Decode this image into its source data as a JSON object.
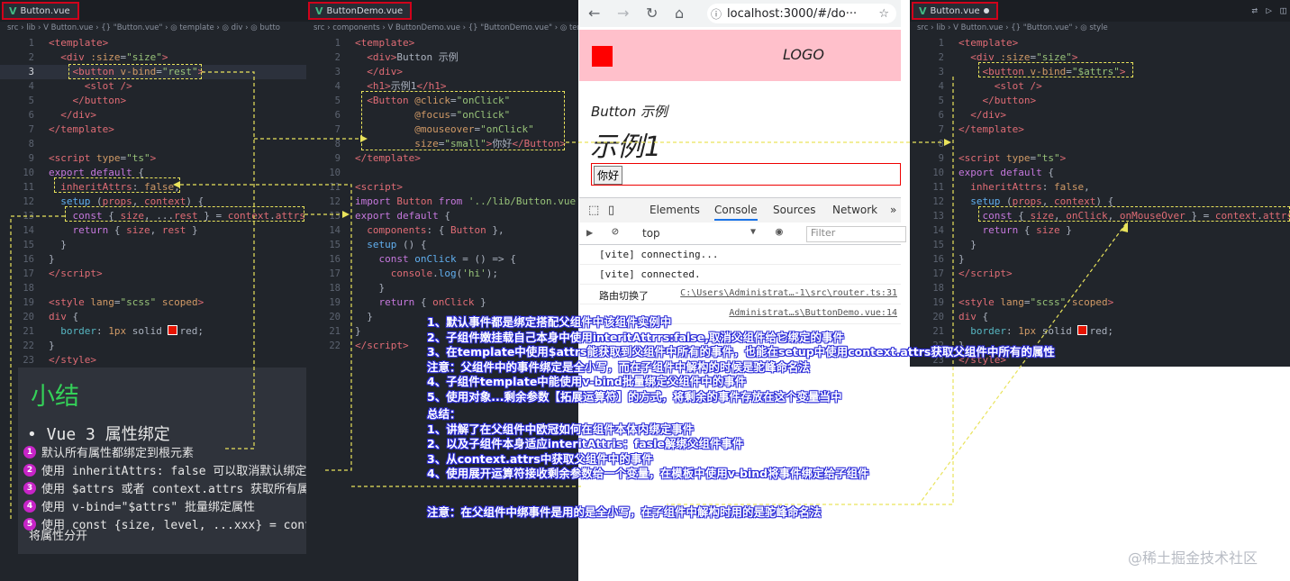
{
  "left_pane": {
    "tab": "Button.vue",
    "breadcrumb": "src › lib › V Button.vue › {} \"Button.vue\" › ◎ template › ◎ div › ◎ butto",
    "lines": [
      {
        "n": "1",
        "html": "<span class='t'>&lt;template&gt;</span>"
      },
      {
        "n": "2",
        "html": "  <span class='t'>&lt;div</span> <span class='a'>:size</span>=<span class='s'>\"size\"</span><span class='t'>&gt;</span>"
      },
      {
        "n": "3",
        "html": "    <span class='t'>&lt;button</span> <span class='a'>v-bind</span>=<span class='s'>\"rest\"</span><span class='t'>&gt;</span>"
      },
      {
        "n": "4",
        "html": "      <span class='t'>&lt;slot /&gt;</span>"
      },
      {
        "n": "5",
        "html": "    <span class='t'>&lt;/button&gt;</span>"
      },
      {
        "n": "6",
        "html": "  <span class='t'>&lt;/div&gt;</span>"
      },
      {
        "n": "7",
        "html": "<span class='t'>&lt;/template&gt;</span>"
      },
      {
        "n": "8",
        "html": ""
      },
      {
        "n": "9",
        "html": "<span class='t'>&lt;script</span> <span class='a'>type</span>=<span class='s'>\"ts\"</span><span class='t'>&gt;</span>"
      },
      {
        "n": "10",
        "html": "<span class='k'>export default</span> {"
      },
      {
        "n": "11",
        "html": "  <span class='t'>inheritAttrs</span>: <span class='a'>false</span>,"
      },
      {
        "n": "12",
        "html": "  <span class='f'>setup</span> (<span class='t'>props</span>, <span class='t'>context</span>) {"
      },
      {
        "n": "13",
        "html": "    <span class='k'>const</span> { <span class='t'>size</span>, ...<span class='t'>rest</span> } = <span class='t'>context</span>.<span class='t'>attrs</span>"
      },
      {
        "n": "14",
        "html": "    <span class='k'>return</span> { <span class='t'>size</span>, <span class='t'>rest</span> }"
      },
      {
        "n": "15",
        "html": "  }"
      },
      {
        "n": "16",
        "html": "}"
      },
      {
        "n": "17",
        "html": "<span class='t'>&lt;/script&gt;</span>"
      },
      {
        "n": "18",
        "html": ""
      },
      {
        "n": "19",
        "html": "<span class='t'>&lt;style</span> <span class='a'>lang</span>=<span class='s'>\"scss\"</span> <span class='a'>scoped</span><span class='t'>&gt;</span>"
      },
      {
        "n": "20",
        "html": "<span class='t'>div</span> {"
      },
      {
        "n": "21",
        "html": "  <span class='c'>border</span>: <span class='a'>1px</span> solid <span class='redsq'></span>red;"
      },
      {
        "n": "22",
        "html": "}"
      },
      {
        "n": "23",
        "html": "<span class='t'>&lt;/style&gt;</span>"
      }
    ]
  },
  "summary": {
    "title": "小结",
    "heading": "• Vue 3 属性绑定",
    "items": [
      {
        "num": "1",
        "text": "默认所有属性都绑定到根元素"
      },
      {
        "num": "2",
        "text": "使用 inheritAttrs: false 可以取消默认绑定"
      },
      {
        "num": "3",
        "text": "使用 $attrs 或者 context.attrs 获取所有属性"
      },
      {
        "num": "4",
        "text": "使用 v-bind=\"$attrs\" 批量绑定属性"
      },
      {
        "num": "5",
        "text": "使用 const {size, level, ...xxx} = context.attrs"
      }
    ],
    "tail": "将属性分开"
  },
  "middle_pane": {
    "tab": "ButtonDemo.vue",
    "breadcrumb": "src › components › V ButtonDemo.vue › {} \"ButtonDemo.vue\" › ◎ template",
    "lines": [
      {
        "n": "1",
        "html": "<span class='t'>&lt;template&gt;</span>"
      },
      {
        "n": "2",
        "html": "  <span class='t'>&lt;div&gt;</span>Button 示例"
      },
      {
        "n": "3",
        "html": "  <span class='t'>&lt;/div&gt;</span>"
      },
      {
        "n": "4",
        "html": "  <span class='t'>&lt;h1&gt;</span>示例1<span class='t'>&lt;/h1&gt;</span>"
      },
      {
        "n": "5",
        "html": "  <span class='t'>&lt;Button</span> <span class='a'>@click</span>=<span class='s'>\"onClick\"</span>"
      },
      {
        "n": "6",
        "html": "          <span class='a'>@focus</span>=<span class='s'>\"onClick\"</span>"
      },
      {
        "n": "7",
        "html": "          <span class='a'>@mouseover</span>=<span class='s'>\"onClick\"</span>"
      },
      {
        "n": "8",
        "html": "          <span class='a'>size</span>=<span class='s'>\"small\"</span><span class='t'>&gt;</span>你好<span class='t'>&lt;/Button&gt;</span>"
      },
      {
        "n": "9",
        "html": "<span class='t'>&lt;/template&gt;</span>"
      },
      {
        "n": "10",
        "html": ""
      },
      {
        "n": "11",
        "html": "<span class='t'>&lt;script&gt;</span>"
      },
      {
        "n": "12",
        "html": "<span class='k'>import</span> <span class='t'>Button</span> <span class='k'>from</span> <span class='s'>'../lib/Button.vue'</span>"
      },
      {
        "n": "13",
        "html": "<span class='k'>export default</span> {"
      },
      {
        "n": "14",
        "html": "  <span class='t'>components</span>: { <span class='t'>Button</span> },"
      },
      {
        "n": "15",
        "html": "  <span class='f'>setup</span> () {"
      },
      {
        "n": "16",
        "html": "    <span class='k'>const</span> <span class='f'>onClick</span> = () =&gt; {"
      },
      {
        "n": "17",
        "html": "      <span class='t'>console</span>.<span class='f'>log</span>(<span class='s'>'hi'</span>);"
      },
      {
        "n": "18",
        "html": "    }"
      },
      {
        "n": "19",
        "html": "    <span class='k'>return</span> { <span class='t'>onClick</span> }"
      },
      {
        "n": "20",
        "html": "  }"
      },
      {
        "n": "21",
        "html": "}"
      },
      {
        "n": "22",
        "html": "<span class='t'>&lt;/script&gt;</span>"
      }
    ]
  },
  "browser": {
    "url": "localhost:3000/#/do···",
    "logo_text": "LOGO",
    "h3": "Button 示例",
    "h1": "示例1",
    "button_label": "你好",
    "devtools_tabs": [
      "Elements",
      "Console",
      "Sources",
      "Network"
    ],
    "context": "top",
    "filter_placeholder": "Filter",
    "console": [
      {
        "msg": "[vite] connecting...",
        "src": ""
      },
      {
        "msg": "[vite] connected.",
        "src": ""
      },
      {
        "msg": "路由切换了",
        "src": "C:\\Users\\Administrat…-1\\src\\router.ts:31"
      },
      {
        "msg": "",
        "src": "Administrat…s\\ButtonDemo.vue:14"
      }
    ]
  },
  "right_pane": {
    "tab": "Button.vue",
    "breadcrumb": "src › lib › V Button.vue › {} \"Button.vue\" › ◎ style",
    "lines": [
      {
        "n": "1",
        "html": "<span class='t'>&lt;template&gt;</span>"
      },
      {
        "n": "2",
        "html": "  <span class='t'>&lt;div</span> <span class='a'>:size</span>=<span class='s'>\"size\"</span><span class='t'>&gt;</span>"
      },
      {
        "n": "3",
        "html": "    <span class='t'>&lt;button</span> <span class='a'>v-bind</span>=<span class='s'>\"$attrs\"</span><span class='t'>&gt;</span>"
      },
      {
        "n": "4",
        "html": "      <span class='t'>&lt;slot /&gt;</span>"
      },
      {
        "n": "5",
        "html": "    <span class='t'>&lt;/button&gt;</span>"
      },
      {
        "n": "6",
        "html": "  <span class='t'>&lt;/div&gt;</span>"
      },
      {
        "n": "7",
        "html": "<span class='t'>&lt;/template&gt;</span>"
      },
      {
        "n": "8",
        "html": ""
      },
      {
        "n": "9",
        "html": "<span class='t'>&lt;script</span> <span class='a'>type</span>=<span class='s'>\"ts\"</span><span class='t'>&gt;</span>"
      },
      {
        "n": "10",
        "html": "<span class='k'>export default</span> {"
      },
      {
        "n": "11",
        "html": "  <span class='t'>inheritAttrs</span>: <span class='a'>false</span>,"
      },
      {
        "n": "12",
        "html": "  <span class='f'>setup</span> (<span class='t'>props</span>, <span class='t'>context</span>) {"
      },
      {
        "n": "13",
        "html": "    <span class='k'>const</span> { <span class='t'>size</span>, <span class='t'>onClick</span>, <span class='t'>onMouseOver</span> } = <span class='t'>context</span>.<span class='t'>attrs</span>"
      },
      {
        "n": "14",
        "html": "    <span class='k'>return</span> { <span class='t'>size</span> }"
      },
      {
        "n": "15",
        "html": "  }"
      },
      {
        "n": "16",
        "html": "}"
      },
      {
        "n": "17",
        "html": "<span class='t'>&lt;/script&gt;</span>"
      },
      {
        "n": "18",
        "html": ""
      },
      {
        "n": "19",
        "html": "<span class='t'>&lt;style</span> <span class='a'>lang</span>=<span class='s'>\"scss\"</span> <span class='a'>scoped</span><span class='t'>&gt;</span>"
      },
      {
        "n": "20",
        "html": "<span class='t'>div</span> {"
      },
      {
        "n": "21",
        "html": "  <span class='c'>border</span>: <span class='a'>1px</span> solid <span class='redsq'></span>red;"
      },
      {
        "n": "22",
        "html": "}"
      },
      {
        "n": "23",
        "html": "<span class='t'>&lt;/style&gt;</span>"
      }
    ]
  },
  "annotations": {
    "block1": [
      "1、默认事件都是绑定搭配父组件中该组件实例中",
      "2、子组件嫩挂载自己本身中使用interitAttrrs:false,取消父组件给它绑定的事件",
      "3、在template中使用$attrs能获取到父组件中所有的事件，也能在setup中使用context.attrs获取父组件中所有的属性",
      "注意：父组件中的事件绑定是全小写，而在子组件中解构的时候是驼峰命名法",
      "4、子组件template中能使用v-bind批量绑定父组件中的事件",
      "5、使用对象...剩余参数【拓展运算符】的方式，将剩余的事件存放在这个变量当中"
    ],
    "block2": [
      "总结：",
      "1、讲解了在父组件中欧冠如何在组件本体内绑定事件",
      "2、以及子组件本身适应interitAttris：fasle解绑父组件事件",
      "3、从context.attrs中获取父组件中的事件",
      "4、使用展开运算符接收剩余参数给一个变量，在模板中使用v-bind将事件绑定给子组件"
    ],
    "note": "注意：在父组件中绑事件是用的是全小写，在子组件中解构时用的是驼峰命名法"
  },
  "watermark": "@稀土掘金技术社区",
  "colors": {
    "accent_red": "#d0021b",
    "dash_yellow": "#e9e35b",
    "highlight_magenta": "#ff00ff",
    "ann_outline": "#2b2bd8"
  }
}
